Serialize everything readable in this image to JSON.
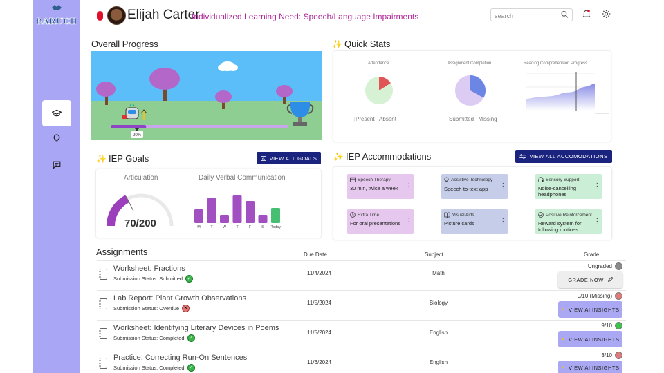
{
  "brand": {
    "logo_text": "BARUCH"
  },
  "header": {
    "student_name": "Elijah Carter",
    "learning_need": "Individualized Learning Need: Speech/Language Impairments",
    "search_placeholder": "search"
  },
  "overall_progress": {
    "title": "Overall Progress",
    "progress_label": "20%",
    "progress_value": 0.2
  },
  "quick_stats": {
    "title": "Quick Stats",
    "attendance": {
      "label": "Attendance",
      "present_legend": "Present",
      "absent_legend": "Absent",
      "absent_fraction": 0.16
    },
    "assignment_completion": {
      "label": "Assignment Completion",
      "submitted_legend": "Submitted",
      "missing_legend": "Missing",
      "missing_fraction": 0.33
    },
    "reading_progress": {
      "label": "Reading Comprehension Progress"
    }
  },
  "iep_goals": {
    "title": "IEP Goals",
    "view_all_label": "VIEW ALL GOALS",
    "articulation": {
      "label": "Articulation",
      "value_text": "70/200",
      "value": 70,
      "max": 200
    },
    "verbal": {
      "label": "Daily Verbal Communication",
      "days": [
        "M",
        "T",
        "W",
        "T",
        "F",
        "S",
        "Today"
      ],
      "values": [
        5,
        9,
        3,
        10,
        8,
        3,
        5.5
      ]
    }
  },
  "iep_accommodations": {
    "title": "IEP Accommodations",
    "view_all_label": "VIEW ALL ACCOMODATIONS",
    "items": [
      {
        "title": "Speech Therapy",
        "desc": "30 min, twice a week",
        "color": "#e6c8ef"
      },
      {
        "title": "Assistive Technology",
        "desc": "Speech-to-text app",
        "color": "#c5cde8"
      },
      {
        "title": "Sensory Support",
        "desc": "Noise-cancelling headphones",
        "color": "#cbeed6"
      },
      {
        "title": "Extra Time",
        "desc": "For oral presentations",
        "color": "#e6c8ef"
      },
      {
        "title": "Visual Aids",
        "desc": "Picture cards",
        "color": "#c5cde8"
      },
      {
        "title": "Positive Reinforcement",
        "desc": "Reward system for following routines",
        "color": "#cbeed6"
      }
    ]
  },
  "assignments": {
    "title": "Assignments",
    "col_due": "Due Date",
    "col_subject": "Subject",
    "col_grade": "Grade",
    "rows": [
      {
        "title": "Worksheet: Fractions",
        "status": "Submission Status: Submitted",
        "status_ok": true,
        "due": "11/4/2024",
        "subject": "Math",
        "grade": "Ungraded",
        "grade_color": "#8a8a8a",
        "action": "GRADE NOW"
      },
      {
        "title": "Lab Report: Plant Growth Observations",
        "status": "Submission Status: Overdue",
        "status_ok": false,
        "due": "11/5/2024",
        "subject": "Biology",
        "grade": "0/10 (Missing)",
        "grade_color": "#e07a7a",
        "action": "VIEW AI INSIGHTS"
      },
      {
        "title": "Worksheet: Identifying Literary Devices in Poems",
        "status": "Submission Status: Completed",
        "status_ok": true,
        "due": "11/5/2024",
        "subject": "English",
        "grade": "9/10",
        "grade_color": "#3cc24a",
        "action": "VIEW AI INSIGHTS"
      },
      {
        "title": "Practice: Correcting Run-On Sentences",
        "status": "Submission Status: Completed",
        "status_ok": true,
        "due": "11/6/2024",
        "subject": "English",
        "grade": "3/10",
        "grade_color": "#e07a7a",
        "action": "VIEW AI INSIGHTS"
      }
    ]
  }
}
